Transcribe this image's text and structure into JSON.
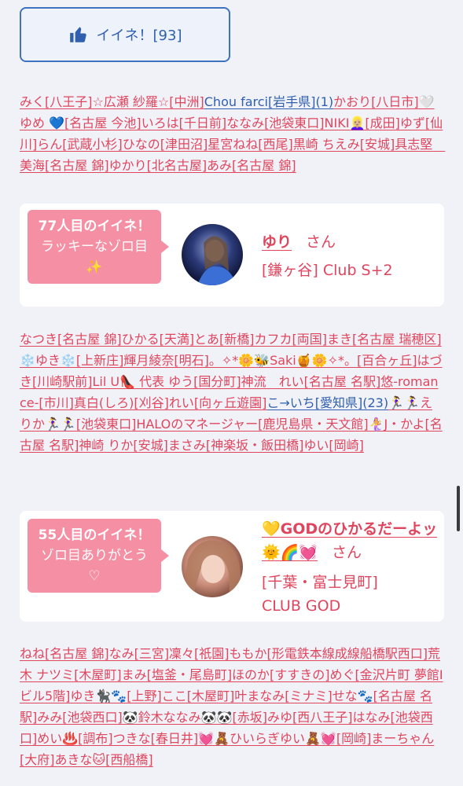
{
  "like_button": {
    "label": "イイネ！[93]",
    "icon": "thumbs-up-icon",
    "color": "#2f5fae"
  },
  "names_block_1": [
    "みく[八王子]☆広瀬 紗羅☆[中洲]",
    "Chou farci[岩手県](1)",
    "かおり[八日市]🤍 ゆめ 💙[名古屋 今池]いろは[千日前]ななみ[池袋東口]NIKI👱🏼‍♀️[成田]ゆず[仙川]らん[武蔵小杉]ひなの[津田沼]星宮ねね[西尾]黒崎 ちえみ[安城]具志堅　美海[名古屋 錦]ゆかり[北名古屋]あみ[名古屋 錦]"
  ],
  "lucky_card_1": {
    "bubble_title": "77人目のイイネ！",
    "bubble_sub": "ラッキーなゾロ目",
    "bubble_icon": "✨",
    "name": "ゆり",
    "san": "さん",
    "shop": "[鎌ヶ谷] Club S+2"
  },
  "names_block_2": [
    "なつき[名古屋 錦]ひかる[天満]とあ[新橋]カフカ[両国]まき[名古屋 瑞穂区]❄️ゆき❄️[上新庄]輝月綾奈[明石]。✧*🌼🐝Saki🍯🌼✧*。[百合ヶ丘]はづき[川崎駅前]Lil U👠 代表 ゆう[国分町]神流　れい[名古屋 名駅]悠-romance-[市川]真白(しろ)[刈谷]れい[向ヶ丘遊園]",
    "こ→いち[愛知県](23)",
    "🏃‍♀️🏃‍♀️えりか🏃‍♀️🏃‍♀️[池袋東口]HALOのマネージャー[鹿児島県・天文館]🧜‍♀️J・かよ[名古屋 名駅]神崎 りか[安城]まさみ[神楽坂・飯田橋]ゆい[岡崎]"
  ],
  "lucky_card_2": {
    "bubble_title": "55人目のイイネ！",
    "bubble_sub": "ゾロ目ありがとう",
    "bubble_icon": "♡",
    "name": "💛GODのひかるだーよッ🌞🌈💓",
    "san": "さん",
    "shop": "[千葉・富士見町] CLUB GOD"
  },
  "names_block_3": [
    "ねね[名古屋 錦]なみ[三宮]凜々[祇園]ももか[形電鉄本線成線船橋駅西口]荒木 ナツミ[木屋町]まみ[塩釜・尾島町]ほのか[すすきの]めぐ[金沢片町 夢館Ⅰビル5階]ゆき🐈‍⬛🐾[上野]ここ[木屋町]叶まなみ[ミナミ]せな🐾[名古屋 名駅]みみ[池袋西口]🐼鈴木ななみ🐼🐼[赤坂]みゆ[西八王子]はなみ[池袋西口]めい♨️[調布]つきな[春日井]💓🧸ひいらぎゆい🧸💓[岡崎]まーちゃん[大府]あきな🐱[西船橋]"
  ],
  "colors": {
    "accent": "#e0455e",
    "link_blue": "#2f5fae",
    "bubble": "#f58fa3",
    "background": "#f0f2f7"
  }
}
